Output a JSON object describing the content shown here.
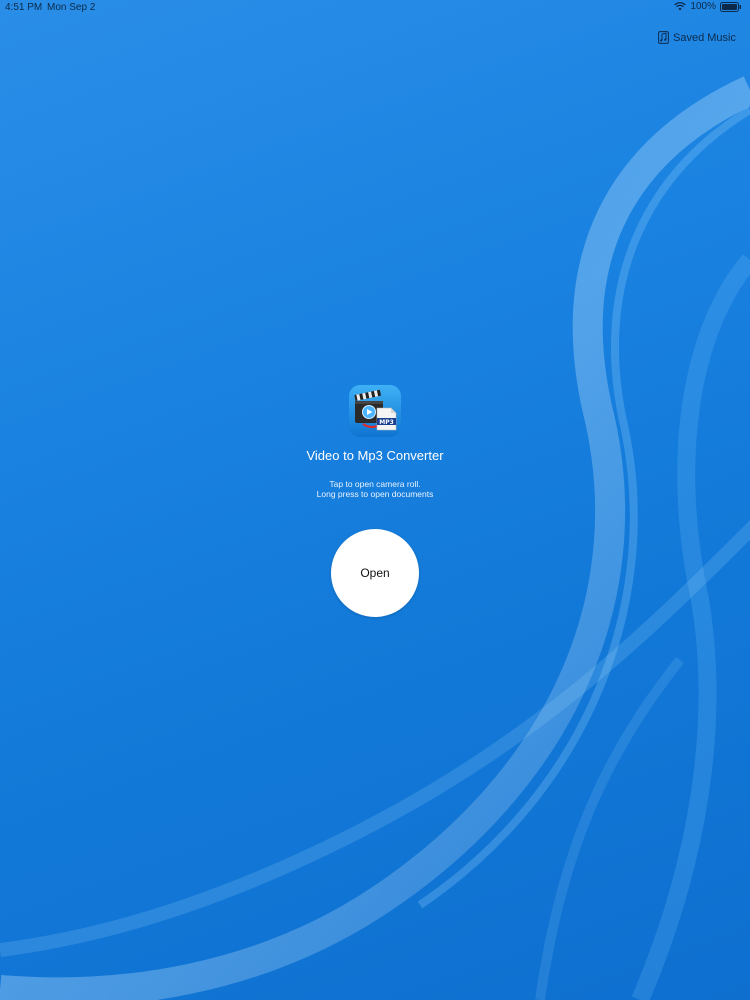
{
  "status_bar": {
    "time": "4:51 PM",
    "date": "Mon Sep 2",
    "battery": "100%"
  },
  "header": {
    "saved_music_label": "Saved Music",
    "saved_music_icon": "music-note-icon"
  },
  "main": {
    "app_icon": "video-to-mp3-app-icon",
    "app_icon_badge": "MP3",
    "title": "Video to Mp3 Converter",
    "hint_line1": "Tap to open camera roll.",
    "hint_line2": "Long press to open documents",
    "open_button_label": "Open"
  },
  "colors": {
    "background": "#1a82e0",
    "button": "#ffffff",
    "status_text": "#0b2a4a"
  }
}
